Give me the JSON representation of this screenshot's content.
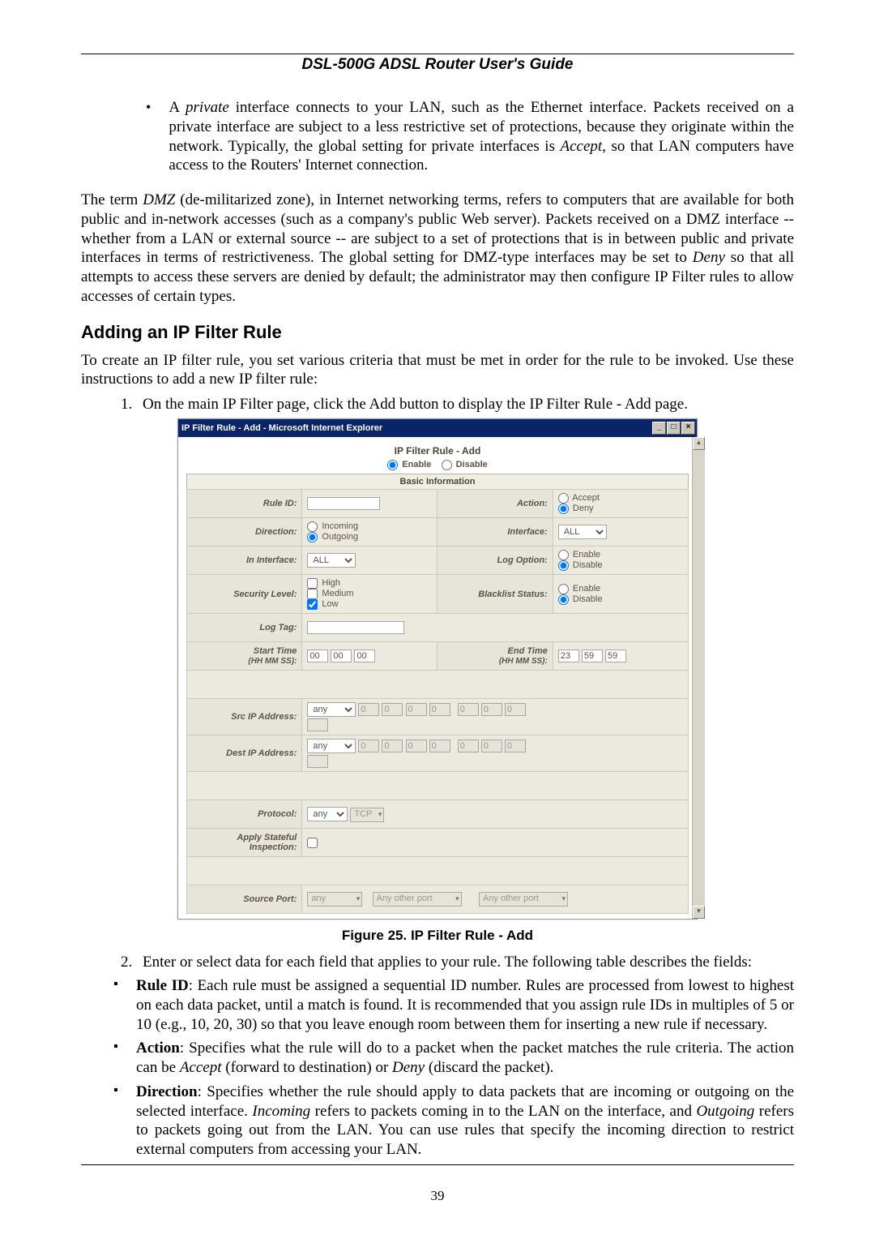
{
  "header": "DSL-500G ADSL Router User's Guide",
  "intro_bullet_pre": "A ",
  "intro_bullet_em": "private",
  "intro_bullet_post1": " interface connects to your LAN, such as the Ethernet interface. Packets received on a private interface are subject to a less restrictive set of protections, because they originate within the network. Typically, the global setting for private interfaces is ",
  "intro_bullet_em2": "Accept",
  "intro_bullet_post2": ", so that LAN computers have access to the Routers' Internet connection.",
  "dmz_para_1a": "The term ",
  "dmz_em1": "DMZ",
  "dmz_para_1b": " (de-militarized zone), in Internet networking terms, refers to computers that are available for both public and in-network accesses (such as a company's public Web server). Packets received on a DMZ interface -- whether from a LAN or external source -- are subject to a set of protections that is in between public and private interfaces in terms of restrictiveness. The global setting for DMZ-type interfaces may be set to ",
  "dmz_em2": "Deny",
  "dmz_para_1c": " so that all attempts to access these servers are denied by default; the administrator may then configure IP Filter rules to allow accesses of certain types.",
  "h2": "Adding an IP Filter Rule",
  "create_para": "To create an IP filter rule, you set various criteria that must be met in order for the rule to be invoked. Use these instructions to add a new IP filter rule:",
  "step1": "On the main IP Filter page, click the Add button to display the IP Filter Rule - Add page.",
  "dialog": {
    "title": "IP Filter Rule - Add - Microsoft Internet Explorer",
    "heading": "IP Filter Rule - Add",
    "enable": "Enable",
    "disable": "Disable",
    "section": "Basic Information",
    "rows": {
      "rule_id": "Rule ID:",
      "action": "Action:",
      "accept": "Accept",
      "deny": "Deny",
      "direction": "Direction:",
      "incoming": "Incoming",
      "outgoing": "Outgoing",
      "interface": "Interface:",
      "interface_val": "ALL",
      "in_interface": "In Interface:",
      "in_interface_val": "ALL",
      "log_option": "Log Option:",
      "enable_opt": "Enable",
      "disable_opt": "Disable",
      "security_level": "Security Level:",
      "high": "High",
      "medium": "Medium",
      "low": "Low",
      "blacklist_status": "Blacklist Status:",
      "log_tag": "Log Tag:",
      "start_time": "Start Time",
      "start_time_sub": "(HH MM SS):",
      "end_time": "End Time",
      "end_time_sub": "(HH MM SS):",
      "st_hh": "00",
      "st_mm": "00",
      "st_ss": "00",
      "et_hh": "23",
      "et_mm": "59",
      "et_ss": "59",
      "src_ip": "Src IP Address:",
      "dest_ip": "Dest IP Address:",
      "any": "any",
      "zero": "0",
      "protocol": "Protocol:",
      "tcp": "TCP",
      "apply_stateful": "Apply Stateful Inspection:",
      "source_port": "Source Port:",
      "any_other_port": "Any other port"
    }
  },
  "fig_caption": "Figure 25. IP Filter Rule - Add",
  "step2": "Enter or select data for each field that applies to your rule. The following table describes the fields:",
  "fields": {
    "rule_id_b": "Rule ID",
    "rule_id_t": ": Each rule must be assigned a sequential ID number. Rules are processed from lowest to highest on each data packet, until a match is found. It is recommended that you assign rule IDs in multiples of 5 or 10 (e.g., 10, 20, 30) so that you leave enough room between them for inserting a new rule if necessary.",
    "action_b": "Action",
    "action_t1": ": Specifies what the rule will do to a packet when the packet matches the rule criteria. The action can be ",
    "action_em1": "Accept",
    "action_t2": " (forward to destination) or ",
    "action_em2": "Deny",
    "action_t3": " (discard the packet).",
    "direction_b": "Direction",
    "direction_t1": ": Specifies whether the rule should apply to data packets that are incoming or outgoing on the selected interface. ",
    "direction_em1": "Incoming",
    "direction_t2": " refers to packets coming in to the LAN on the interface, and ",
    "direction_em2": "Outgoing",
    "direction_t3": " refers to packets going out from the LAN. You can use rules that specify the incoming direction to restrict external computers from accessing your LAN."
  },
  "page_num": "39"
}
